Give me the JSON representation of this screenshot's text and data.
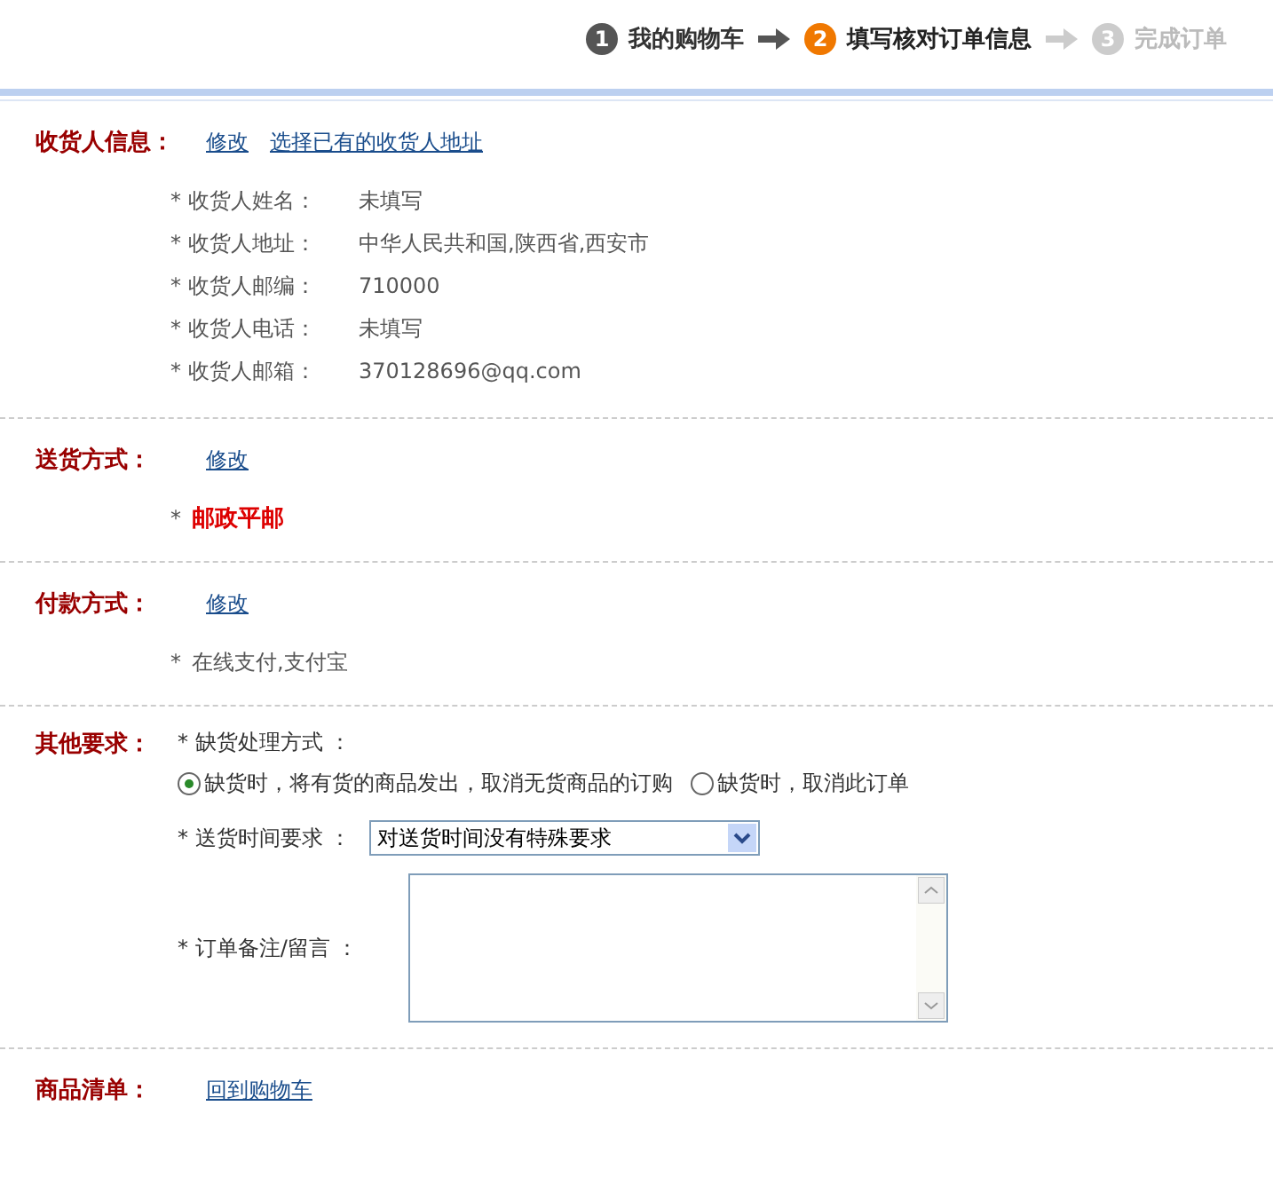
{
  "steps": [
    {
      "number": "1",
      "label": "我的购物车",
      "selected": false,
      "disabled": false
    },
    {
      "number": "2",
      "label": "填写核对订单信息",
      "selected": true,
      "disabled": false
    },
    {
      "number": "3",
      "label": "完成订单",
      "selected": false,
      "disabled": true
    }
  ],
  "sections": [
    {
      "kind": "info",
      "title": "收货人信息：",
      "links": [
        "修改",
        "选择已有的收货人地址"
      ],
      "rows": [
        {
          "label": "* 收货人姓名：",
          "value": "未填写"
        },
        {
          "label": "* 收货人地址：",
          "value": "中华人民共和国,陕西省,西安市"
        },
        {
          "label": "* 收货人邮编：",
          "value": "710000"
        },
        {
          "label": "* 收货人电话：",
          "value": "未填写"
        },
        {
          "label": "* 收货人邮箱：",
          "value": "370128696@qq.com"
        }
      ]
    },
    {
      "kind": "choice",
      "title": "送货方式：",
      "links": [
        "修改"
      ],
      "mark": "*",
      "value": "邮政平邮",
      "emphasis": true
    },
    {
      "kind": "choice",
      "title": "付款方式：",
      "links": [
        "修改"
      ],
      "mark": "*",
      "value": "在线支付,支付宝",
      "emphasis": false
    },
    {
      "kind": "form",
      "title": "其他要求：",
      "shortage_label": "* 缺货处理方式 ：",
      "options": [
        {
          "label": "缺货时，将有货的商品发出，取消无货商品的订购",
          "selected": true
        },
        {
          "label": "缺货时，取消此订单",
          "selected": false
        }
      ],
      "time_label": "* 送货时间要求 ：",
      "time_value": "对送货时间没有特殊要求",
      "note_label": "* 订单备注/留言 ："
    },
    {
      "kind": "links",
      "title": "商品清单：",
      "links": [
        "回到购物车"
      ]
    }
  ]
}
